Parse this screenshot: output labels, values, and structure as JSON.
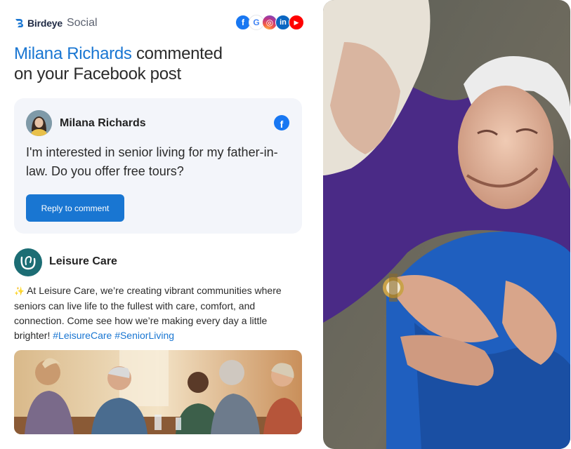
{
  "brand": {
    "name": "Birdeye",
    "product": "Social"
  },
  "socials": [
    {
      "icon": "facebook-icon",
      "glyph": "f"
    },
    {
      "icon": "google-icon",
      "glyph": "G"
    },
    {
      "icon": "instagram-icon",
      "glyph": "◎"
    },
    {
      "icon": "linkedin-icon",
      "glyph": "in"
    },
    {
      "icon": "youtube-icon",
      "glyph": "▶"
    }
  ],
  "headline": {
    "name": "Milana Richards",
    "action_line1": "commented",
    "action_line2": "on your Facebook post"
  },
  "comment": {
    "author": "Milana Richards",
    "platform_icon": "facebook-icon",
    "text": "I'm interested in senior living for my father-in-law. Do you offer free tours?",
    "reply_label": "Reply to comment"
  },
  "post": {
    "author": "Leisure Care",
    "text_prefix": "✨",
    "text": " At Leisure Care, we’re creating vibrant communities where seniors can live life to the fullest with care, comfort, and connection. Come see how we’re making every day a little brighter! ",
    "hashtags": "#LeisureCare #SeniorLiving"
  },
  "colors": {
    "accent": "#1976d2",
    "card_bg": "#f3f5fa",
    "facebook": "#1877f2"
  }
}
